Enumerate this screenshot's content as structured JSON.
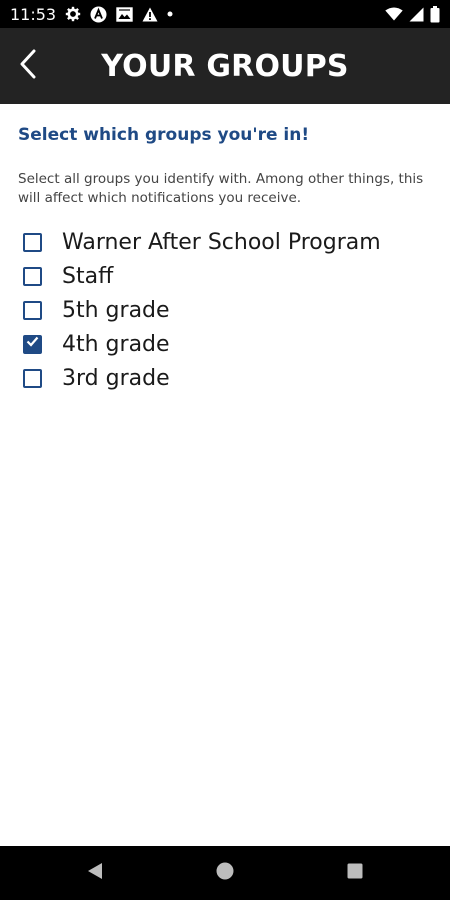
{
  "status_bar": {
    "time": "11:53",
    "left_icons": [
      "settings-icon",
      "app-a-icon",
      "photo-icon",
      "warning-icon",
      "dot-icon"
    ],
    "right_icons": [
      "wifi-icon",
      "signal-icon",
      "battery-icon"
    ]
  },
  "header": {
    "title": "YOUR GROUPS",
    "back_icon": "back-chevron-icon",
    "background": "#232323"
  },
  "main": {
    "heading": "Select which groups you're in!",
    "description": "Select all groups you identify with. Among other things, this will affect which notifications you receive.",
    "accent_color": "#1f4a85",
    "groups": [
      {
        "label": "Warner After School Program",
        "checked": false
      },
      {
        "label": "Staff",
        "checked": false
      },
      {
        "label": "5th grade",
        "checked": false
      },
      {
        "label": "4th grade",
        "checked": true
      },
      {
        "label": "3rd grade",
        "checked": false
      }
    ]
  },
  "nav_bar": {
    "buttons": [
      "back-triangle-icon",
      "home-circle-icon",
      "recents-square-icon"
    ]
  }
}
